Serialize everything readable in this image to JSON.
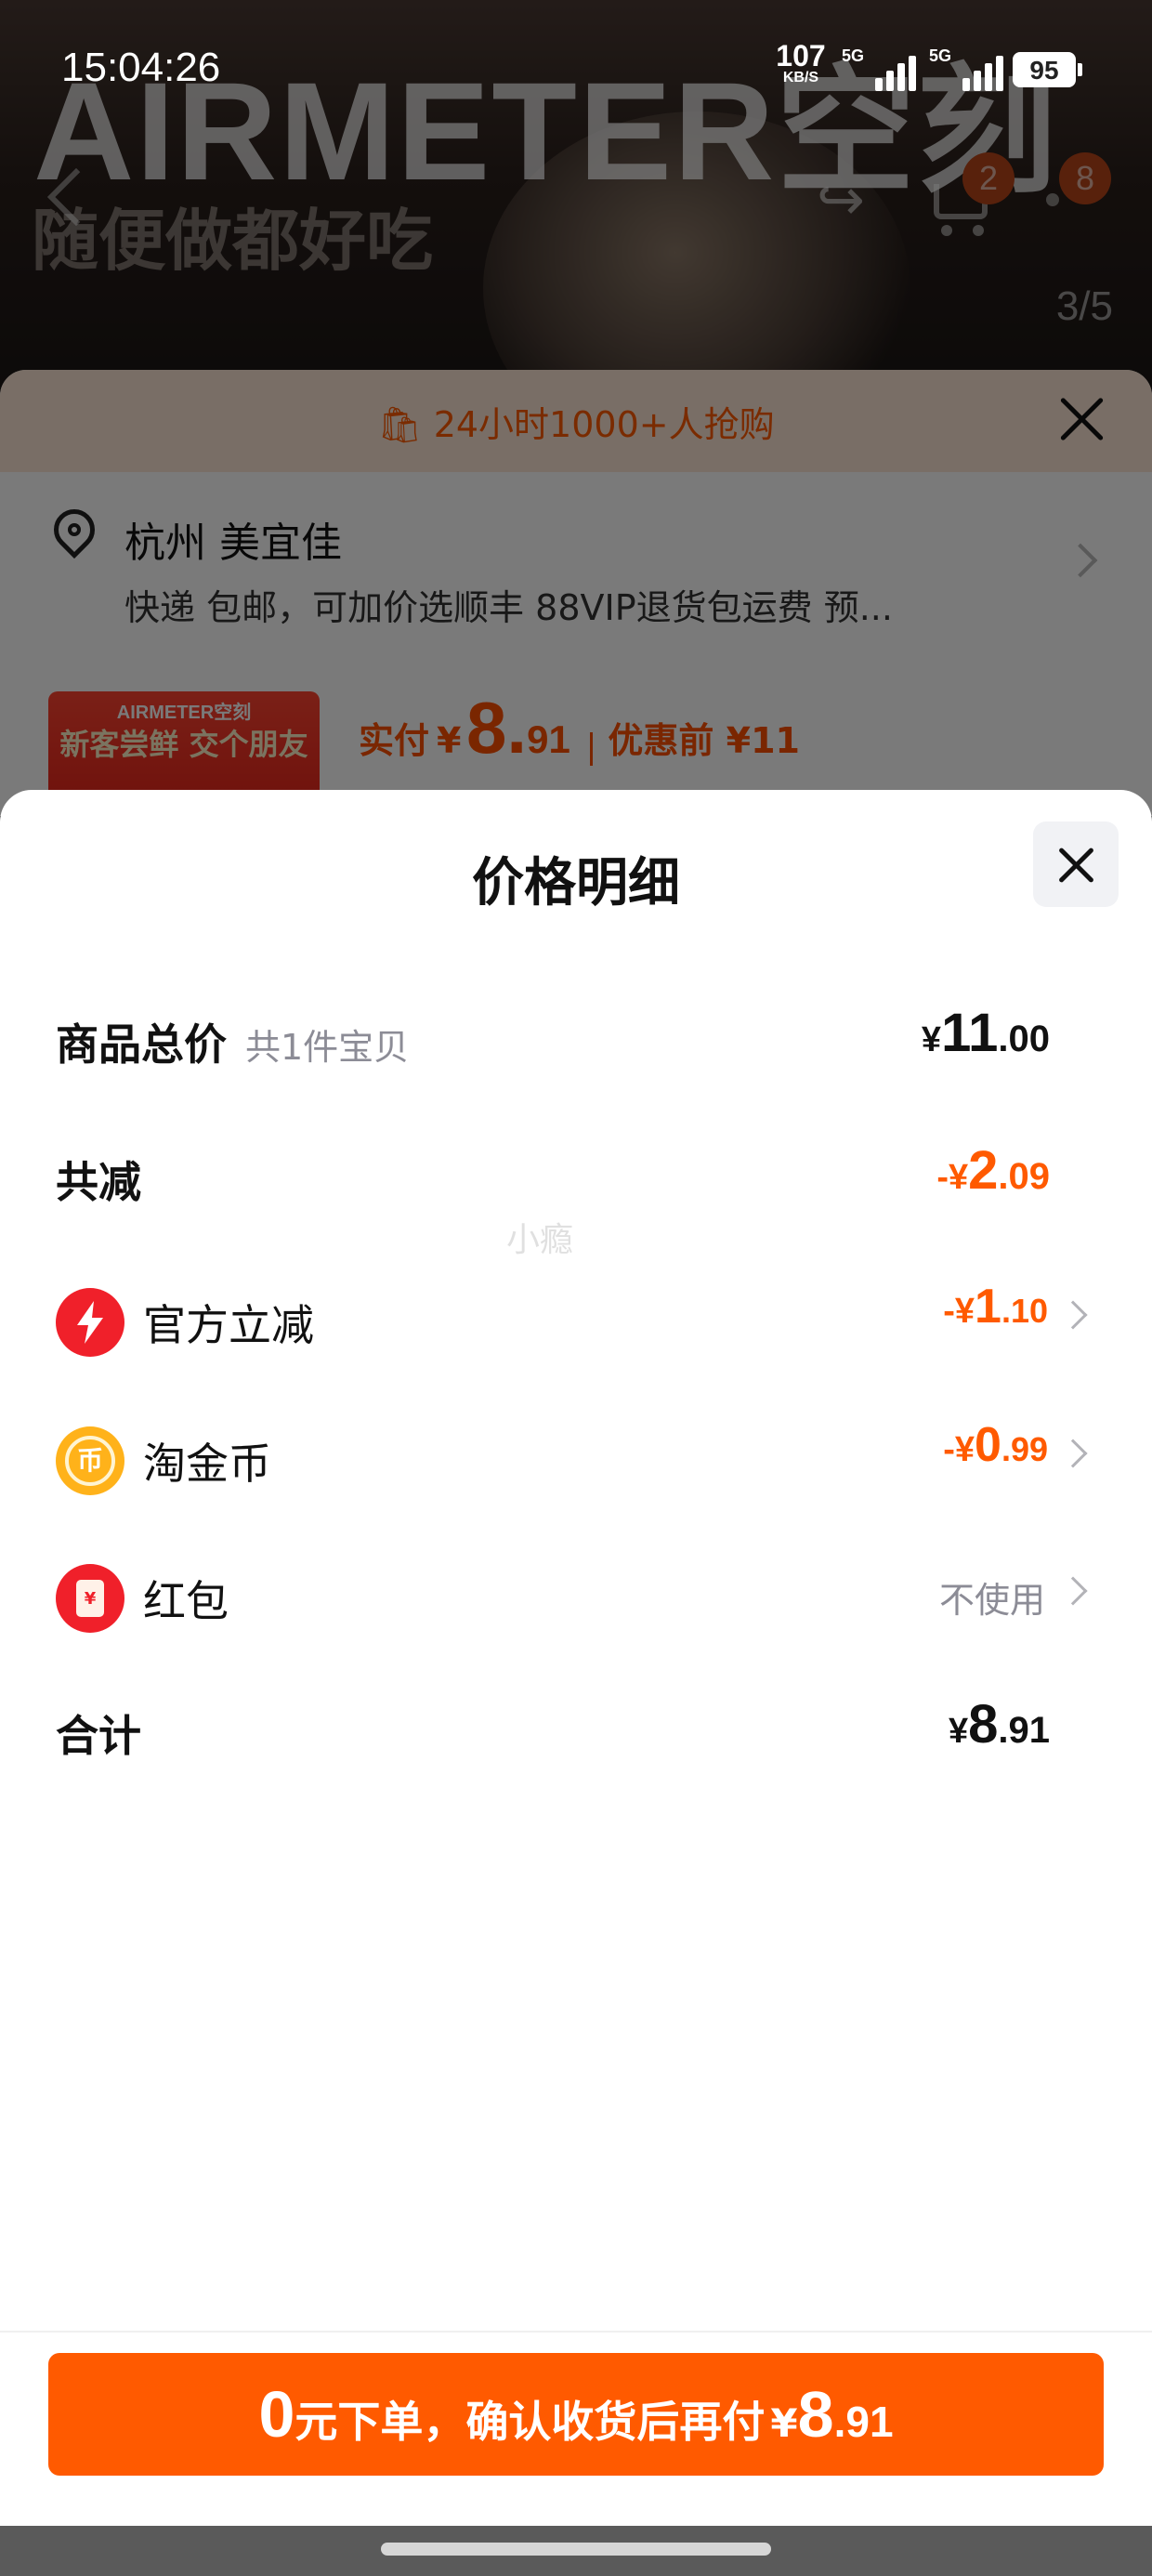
{
  "status_bar": {
    "time": "15:04:26",
    "net_speed_value": "107",
    "net_speed_unit": "KB/S",
    "signal_1_label": "5G",
    "signal_2_label": "5G",
    "battery": "95"
  },
  "product_hero": {
    "brand_wordmark": "AIRMETER空刻",
    "slogan": "随便做都好吃",
    "image_counter": "3/5",
    "cart_badge": "2",
    "more_badge": "8"
  },
  "purchase_sheet": {
    "banner_text": "24小时1000+人抢购",
    "location_title": "杭州 美宜佳",
    "location_subtitle": "快递 包邮，可加价选顺丰 88VIP退货包运费 预...",
    "promo_brand": "AIRMETER空刻",
    "promo_text": "新客尝鲜 交个朋友",
    "paid_label": "实付",
    "paid_currency": "¥",
    "paid_int": "8.",
    "paid_frac": "91",
    "original_price": "优惠前 ¥11"
  },
  "price_detail": {
    "title": "价格明细",
    "watermark": "小瘾",
    "rows": {
      "subtotal": {
        "label": "商品总价",
        "sub": "共1件宝贝",
        "currency": "¥",
        "int": "11",
        "frac": ".00"
      },
      "discount_total": {
        "label": "共减",
        "currency": "-¥",
        "int": "2",
        "frac": ".09"
      },
      "official_discount": {
        "label": "官方立减",
        "icon": "lightning-icon",
        "currency": "-¥",
        "int": "1",
        "frac": ".10"
      },
      "taojinbi": {
        "label": "淘金币",
        "icon": "coin-icon",
        "icon_glyph": "币",
        "currency": "-¥",
        "int": "0",
        "frac": ".99"
      },
      "red_packet": {
        "label": "红包",
        "icon": "red-envelope-icon",
        "icon_glyph": "¥",
        "value": "不使用"
      },
      "total": {
        "label": "合计",
        "currency": "¥",
        "int": "8",
        "frac": ".91"
      }
    }
  },
  "cta": {
    "zero": "0",
    "text": "元下单，确认收货后再付",
    "currency": "¥",
    "int": "8",
    "frac": ".91"
  },
  "colors": {
    "accent": "#ff5a00",
    "bolt_red": "#f0202a",
    "coin_gold": "#ffb21a",
    "muted": "#8c8c96"
  }
}
